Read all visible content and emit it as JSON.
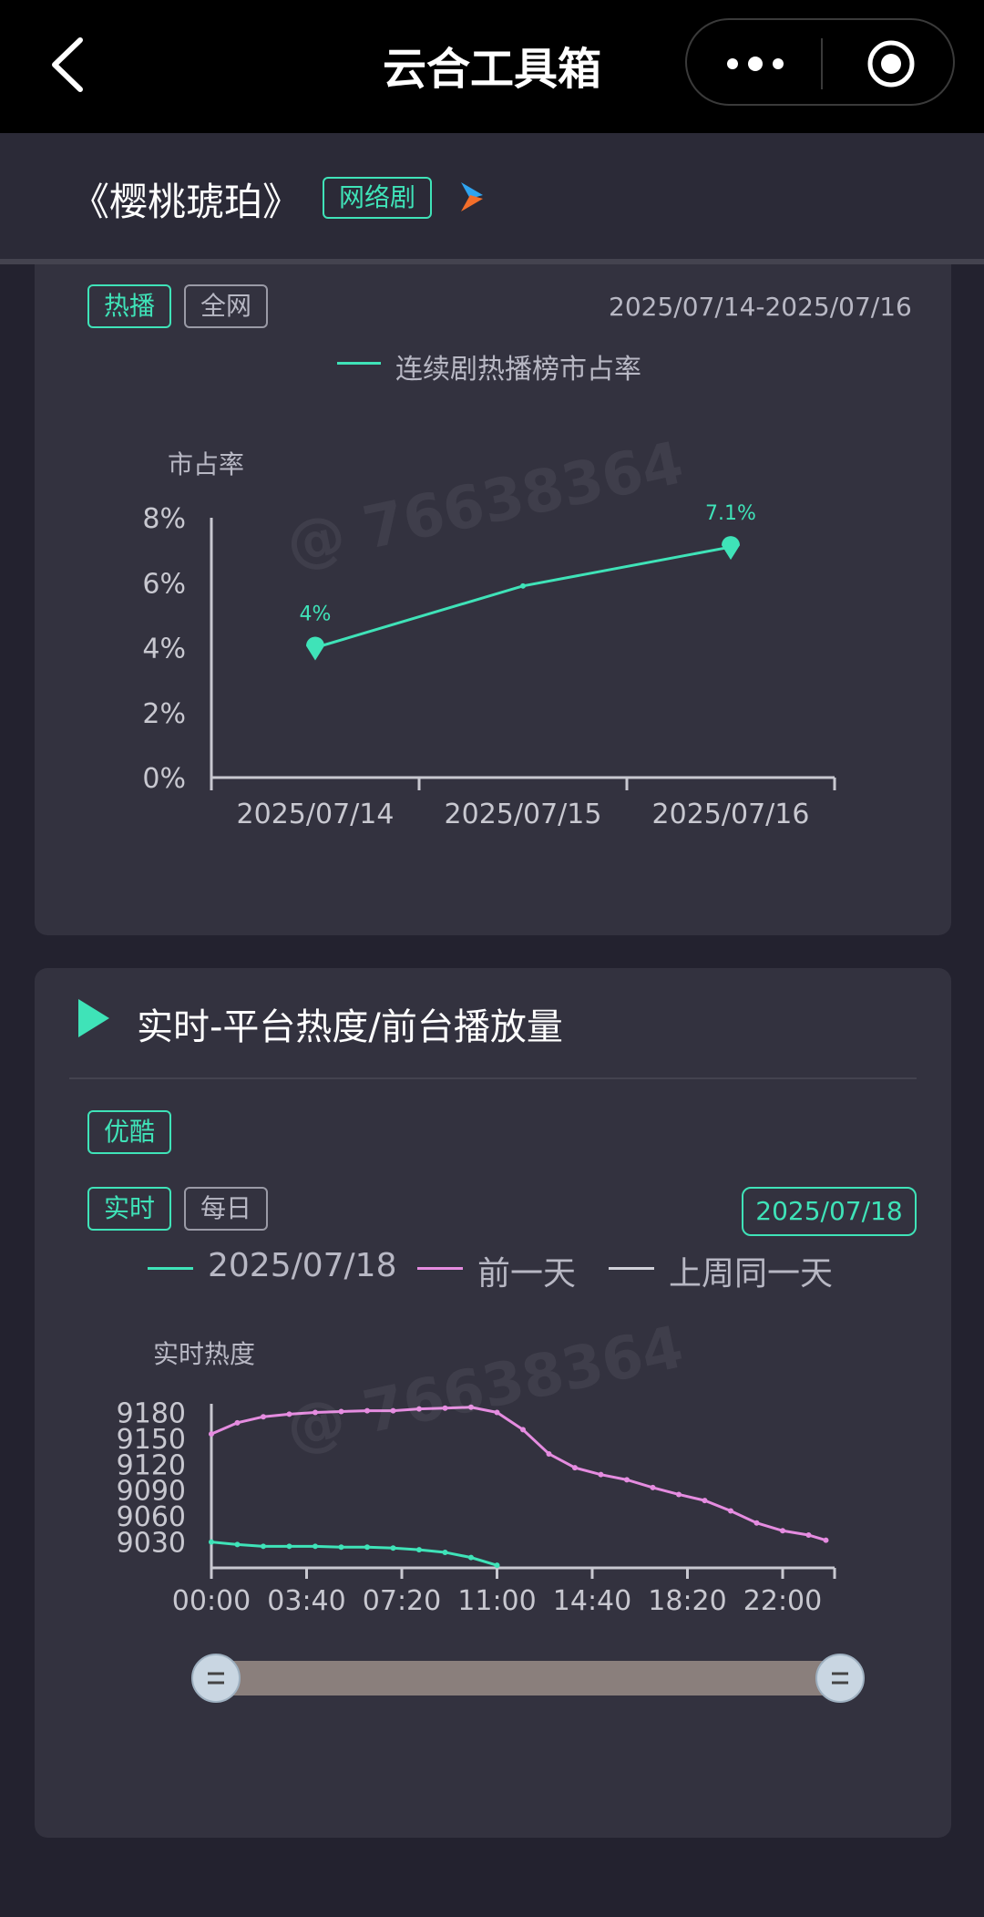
{
  "nav": {
    "title": "云合工具箱"
  },
  "drama": {
    "title": "《樱桃琥珀》",
    "genre": "网络剧",
    "platform_icon": "youku-logo"
  },
  "card1": {
    "tabs": {
      "active": "热播",
      "inactive": "全网"
    },
    "date_range": "2025/07/14-2025/07/16",
    "legend": "连续剧热播榜市占率",
    "y_axis_label": "市占率",
    "legend_color": "#3fe3b8"
  },
  "card2": {
    "title": "实时-平台热度/前台播放量",
    "platform_tag": "优酷",
    "tabs": {
      "active": "实时",
      "inactive": "每日"
    },
    "date_button": "2025/07/18",
    "legend": [
      {
        "name": "2025/07/18",
        "color": "#3fe3b8"
      },
      {
        "name": "前一天",
        "color": "#e58ce0"
      },
      {
        "name": "上周同一天",
        "color": "#d0d0d8"
      }
    ],
    "y_axis_label": "实时热度",
    "slider": {
      "start": 0.0,
      "end": 1.0
    }
  },
  "watermark": "@ 76638364",
  "chart_data": [
    {
      "type": "line",
      "categories": [
        "2025/07/14",
        "2025/07/15",
        "2025/07/16"
      ],
      "series": [
        {
          "name": "连续剧热播榜市占率",
          "values": [
            4.0,
            5.9,
            7.1
          ],
          "color": "#3fe3b8"
        }
      ],
      "point_labels": [
        "4%",
        "",
        "7.1%"
      ],
      "ylabel": "市占率",
      "yticks": [
        "0%",
        "2%",
        "4%",
        "6%",
        "8%"
      ],
      "ylim": [
        0,
        8
      ],
      "grid": false
    },
    {
      "type": "line",
      "x_ticks": [
        "00:00",
        "03:40",
        "07:20",
        "11:00",
        "14:40",
        "18:20",
        "22:00"
      ],
      "ylabel": "实时热度",
      "yticks": [
        "9030",
        "9060",
        "9090",
        "9120",
        "9150",
        "9180"
      ],
      "ylim": [
        9000,
        9190
      ],
      "x_range_minutes": [
        0,
        1440
      ],
      "series": [
        {
          "name": "2025/07/18",
          "color": "#3fe3b8",
          "x": [
            0,
            60,
            120,
            180,
            240,
            300,
            360,
            420,
            480,
            540,
            600,
            660
          ],
          "values": [
            9030,
            9027,
            9025,
            9025,
            9025,
            9024,
            9024,
            9023,
            9021,
            9018,
            9012,
            9003
          ]
        },
        {
          "name": "前一天",
          "color": "#e58ce0",
          "x": [
            0,
            60,
            120,
            180,
            240,
            300,
            360,
            420,
            480,
            540,
            600,
            660,
            720,
            780,
            840,
            900,
            960,
            1020,
            1080,
            1140,
            1200,
            1260,
            1320,
            1380,
            1420
          ],
          "values": [
            9155,
            9168,
            9175,
            9178,
            9180,
            9181,
            9182,
            9182,
            9184,
            9185,
            9186,
            9180,
            9160,
            9132,
            9116,
            9108,
            9102,
            9093,
            9085,
            9078,
            9066,
            9052,
            9043,
            9038,
            9032
          ]
        },
        {
          "name": "上周同一天",
          "color": "#d0d0d8",
          "x": [],
          "values": []
        }
      ],
      "grid": false
    }
  ]
}
